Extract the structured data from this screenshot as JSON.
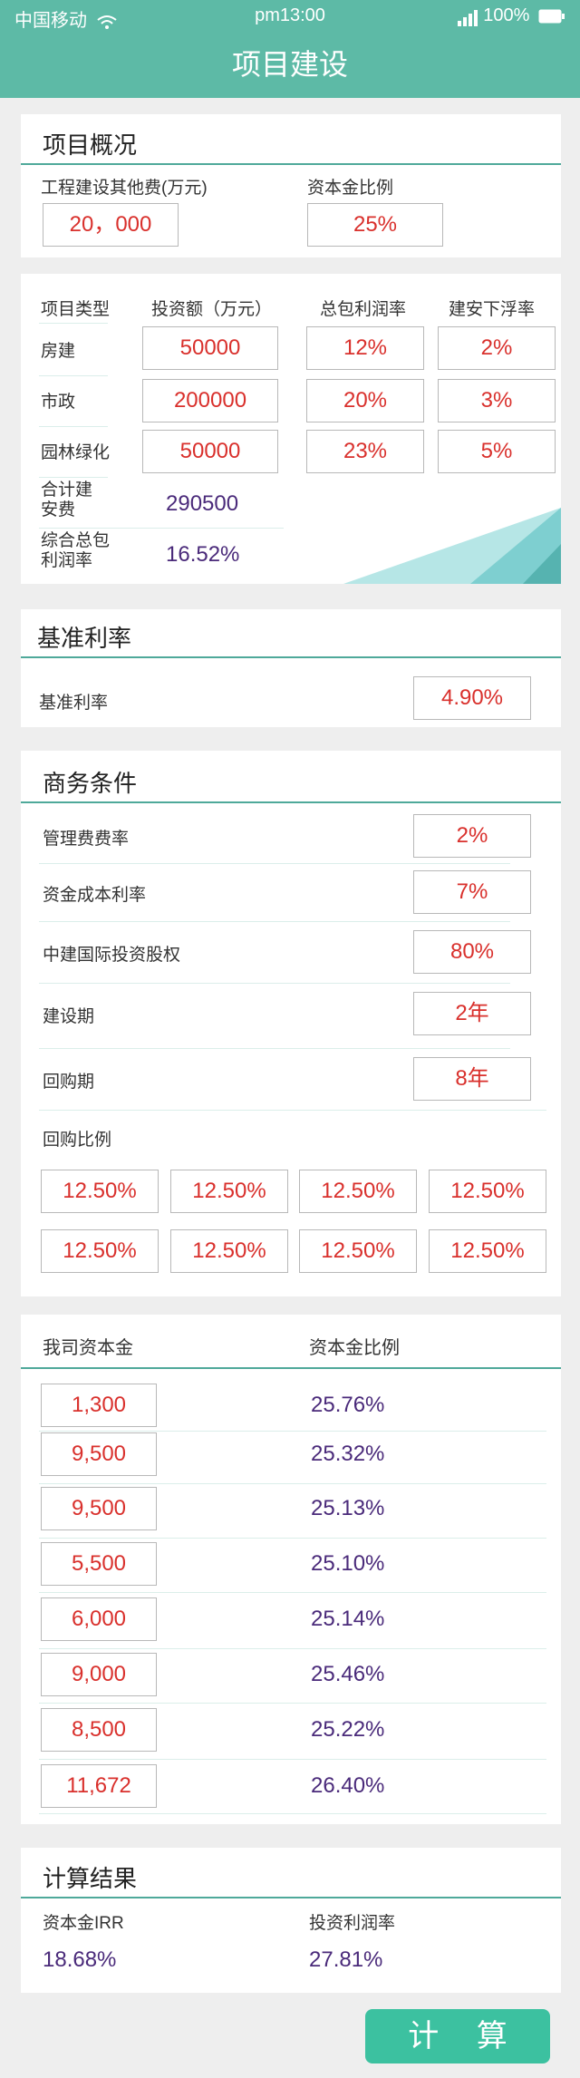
{
  "status_bar": {
    "carrier": "中国移动",
    "time": "pm13:00",
    "battery": "100%"
  },
  "nav": {
    "title": "项目建设"
  },
  "overview": {
    "title": "项目概况",
    "other_fee_label": "工程建设其他费(万元)",
    "other_fee_value": "20，000",
    "capital_ratio_label": "资本金比例",
    "capital_ratio_value": "25%"
  },
  "projects": {
    "headers": [
      "项目类型",
      "投资额（万元）",
      "总包利润率",
      "建安下浮率"
    ],
    "rows": [
      {
        "type": "房建",
        "invest": "50000",
        "profit": "12%",
        "float": "2%"
      },
      {
        "type": "市政",
        "invest": "200000",
        "profit": "20%",
        "float": "3%"
      },
      {
        "type": "园林绿化",
        "invest": "50000",
        "profit": "23%",
        "float": "5%"
      }
    ],
    "total_label": "合计建安费",
    "total_value": "290500",
    "avg_label": "综合总包利润率",
    "avg_value": "16.52%"
  },
  "benchmark": {
    "title": "基准利率",
    "label": "基准利率",
    "value": "4.90%"
  },
  "business": {
    "title": "商务条件",
    "items": [
      {
        "label": "管理费费率",
        "value": "2%"
      },
      {
        "label": "资金成本利率",
        "value": "7%"
      },
      {
        "label": "中建国际投资股权",
        "value": "80%"
      },
      {
        "label": "建设期",
        "value": "2年"
      },
      {
        "label": "回购期",
        "value": "8年"
      }
    ],
    "buyback_label": "回购比例",
    "buyback_values": [
      "12.50%",
      "12.50%",
      "12.50%",
      "12.50%",
      "12.50%",
      "12.50%",
      "12.50%",
      "12.50%"
    ]
  },
  "capital": {
    "col1": "我司资本金",
    "col2": "资本金比例",
    "rows": [
      {
        "amount": "1,300",
        "ratio": "25.76%"
      },
      {
        "amount": "9,500",
        "ratio": "25.32%"
      },
      {
        "amount": "9,500",
        "ratio": "25.13%"
      },
      {
        "amount": "5,500",
        "ratio": "25.10%"
      },
      {
        "amount": "6,000",
        "ratio": "25.14%"
      },
      {
        "amount": "9,000",
        "ratio": "25.46%"
      },
      {
        "amount": "8,500",
        "ratio": "25.22%"
      },
      {
        "amount": "11,672",
        "ratio": "26.40%"
      }
    ]
  },
  "results": {
    "title": "计算结果",
    "irr_label": "资本金IRR",
    "irr_value": "18.68%",
    "profit_label": "投资利润率",
    "profit_value": "27.81%"
  },
  "action": {
    "calc_label": "计 算"
  },
  "colors": {
    "header": "#5dbaa6",
    "accent_line": "#4fa99a",
    "input_text": "#d9302c",
    "value_text": "#4a2a7a",
    "button": "#3cc1a0"
  }
}
